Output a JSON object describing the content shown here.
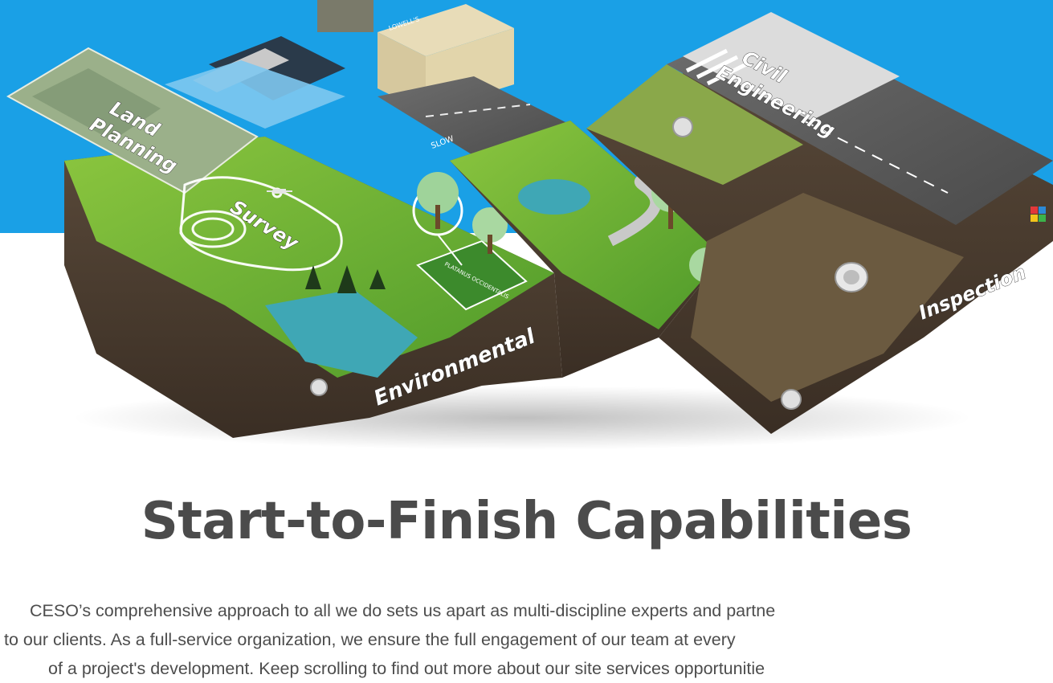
{
  "hero": {
    "labels": {
      "land_planning_1": "Land",
      "land_planning_2": "Planning",
      "survey": "Survey",
      "environmental": "Environmental",
      "civil_1": "Civil",
      "civil_2": "Engineering",
      "inspection": "Inspection",
      "sign_slow": "SLOW",
      "building_sign": "LOWELL'S",
      "plaque": "PLATANUS OCCIDENTALIS"
    }
  },
  "section": {
    "title": "Start-to-Finish Capabilities",
    "intro_lines": [
      "CESO’s comprehensive approach to all we do sets us apart as multi-discipline experts and partne",
      "to our clients. As a full-service organization, we ensure the full engagement of our team at every",
      "of a project's development. Keep scrolling to find out more about our site services opportunitie"
    ]
  },
  "colors": {
    "sky": "#1aa0e6",
    "heading": "#4b4b4b",
    "body_text": "#4d4d4d"
  }
}
